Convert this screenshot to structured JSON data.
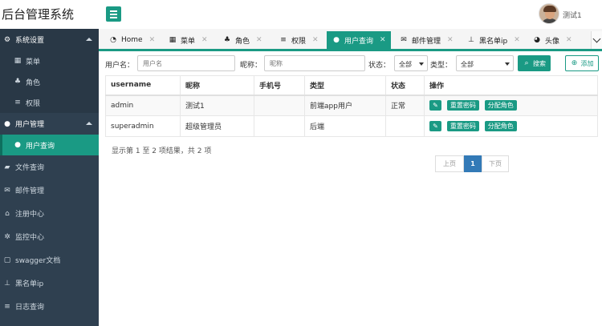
{
  "app": {
    "title": "后台管理系统"
  },
  "user": {
    "name": "测试1"
  },
  "sidebar": {
    "groups": [
      {
        "label": "系统设置",
        "icon": "gears-icon"
      },
      {
        "label": "用户管理",
        "icon": "user-icon"
      }
    ],
    "system_items": [
      {
        "label": "菜单",
        "icon": "windows-icon"
      },
      {
        "label": "角色",
        "icon": "users-icon"
      },
      {
        "label": "权限",
        "icon": "list-icon"
      }
    ],
    "user_items": [
      {
        "label": "用户查询",
        "icon": "user-icon"
      }
    ],
    "items": [
      {
        "label": "文件查询",
        "icon": "folder-icon"
      },
      {
        "label": "邮件管理",
        "icon": "envelope-icon"
      },
      {
        "label": "注册中心",
        "icon": "bank-icon"
      },
      {
        "label": "监控中心",
        "icon": "spinner-icon"
      },
      {
        "label": "swagger文档",
        "icon": "file-icon"
      },
      {
        "label": "黑名单ip",
        "icon": "pushpin-icon"
      },
      {
        "label": "日志查询",
        "icon": "list-icon"
      }
    ]
  },
  "tabs": [
    {
      "label": "Home",
      "icon": "dashboard-icon"
    },
    {
      "label": "菜单",
      "icon": "windows-icon"
    },
    {
      "label": "角色",
      "icon": "users-icon"
    },
    {
      "label": "权限",
      "icon": "list-icon"
    },
    {
      "label": "用户查询",
      "icon": "user-icon"
    },
    {
      "label": "邮件管理",
      "icon": "envelope-icon"
    },
    {
      "label": "黑名单ip",
      "icon": "pushpin-icon"
    },
    {
      "label": "头像",
      "icon": "user-circle-icon"
    }
  ],
  "filters": {
    "username_label": "用户名：",
    "username_placeholder": "用户名",
    "nickname_label": "昵称：",
    "nickname_placeholder": "昵称",
    "status_label": "状态：",
    "status_value": "全部",
    "type_label": "类型：",
    "type_value": "全部",
    "search_label": "搜索",
    "add_label": "添加"
  },
  "table": {
    "headers": [
      "username",
      "昵称",
      "手机号",
      "类型",
      "状态",
      "操作"
    ],
    "rows": [
      {
        "username": "admin",
        "nickname": "测试1",
        "phone": "",
        "type": "前端app用户",
        "status": "正常"
      },
      {
        "username": "superadmin",
        "nickname": "超级管理员",
        "phone": "",
        "type": "后端",
        "status": ""
      }
    ],
    "actions": {
      "reset": "重置密码",
      "assign": "分配角色"
    }
  },
  "pagination": {
    "summary": "显示第 1 至 2 项结果，共 2 项",
    "prev": "上页",
    "current": "1",
    "next": "下页"
  },
  "colors": {
    "accent": "#1a9a84",
    "sidebar": "#2f4050",
    "page_active": "#337ab7"
  }
}
